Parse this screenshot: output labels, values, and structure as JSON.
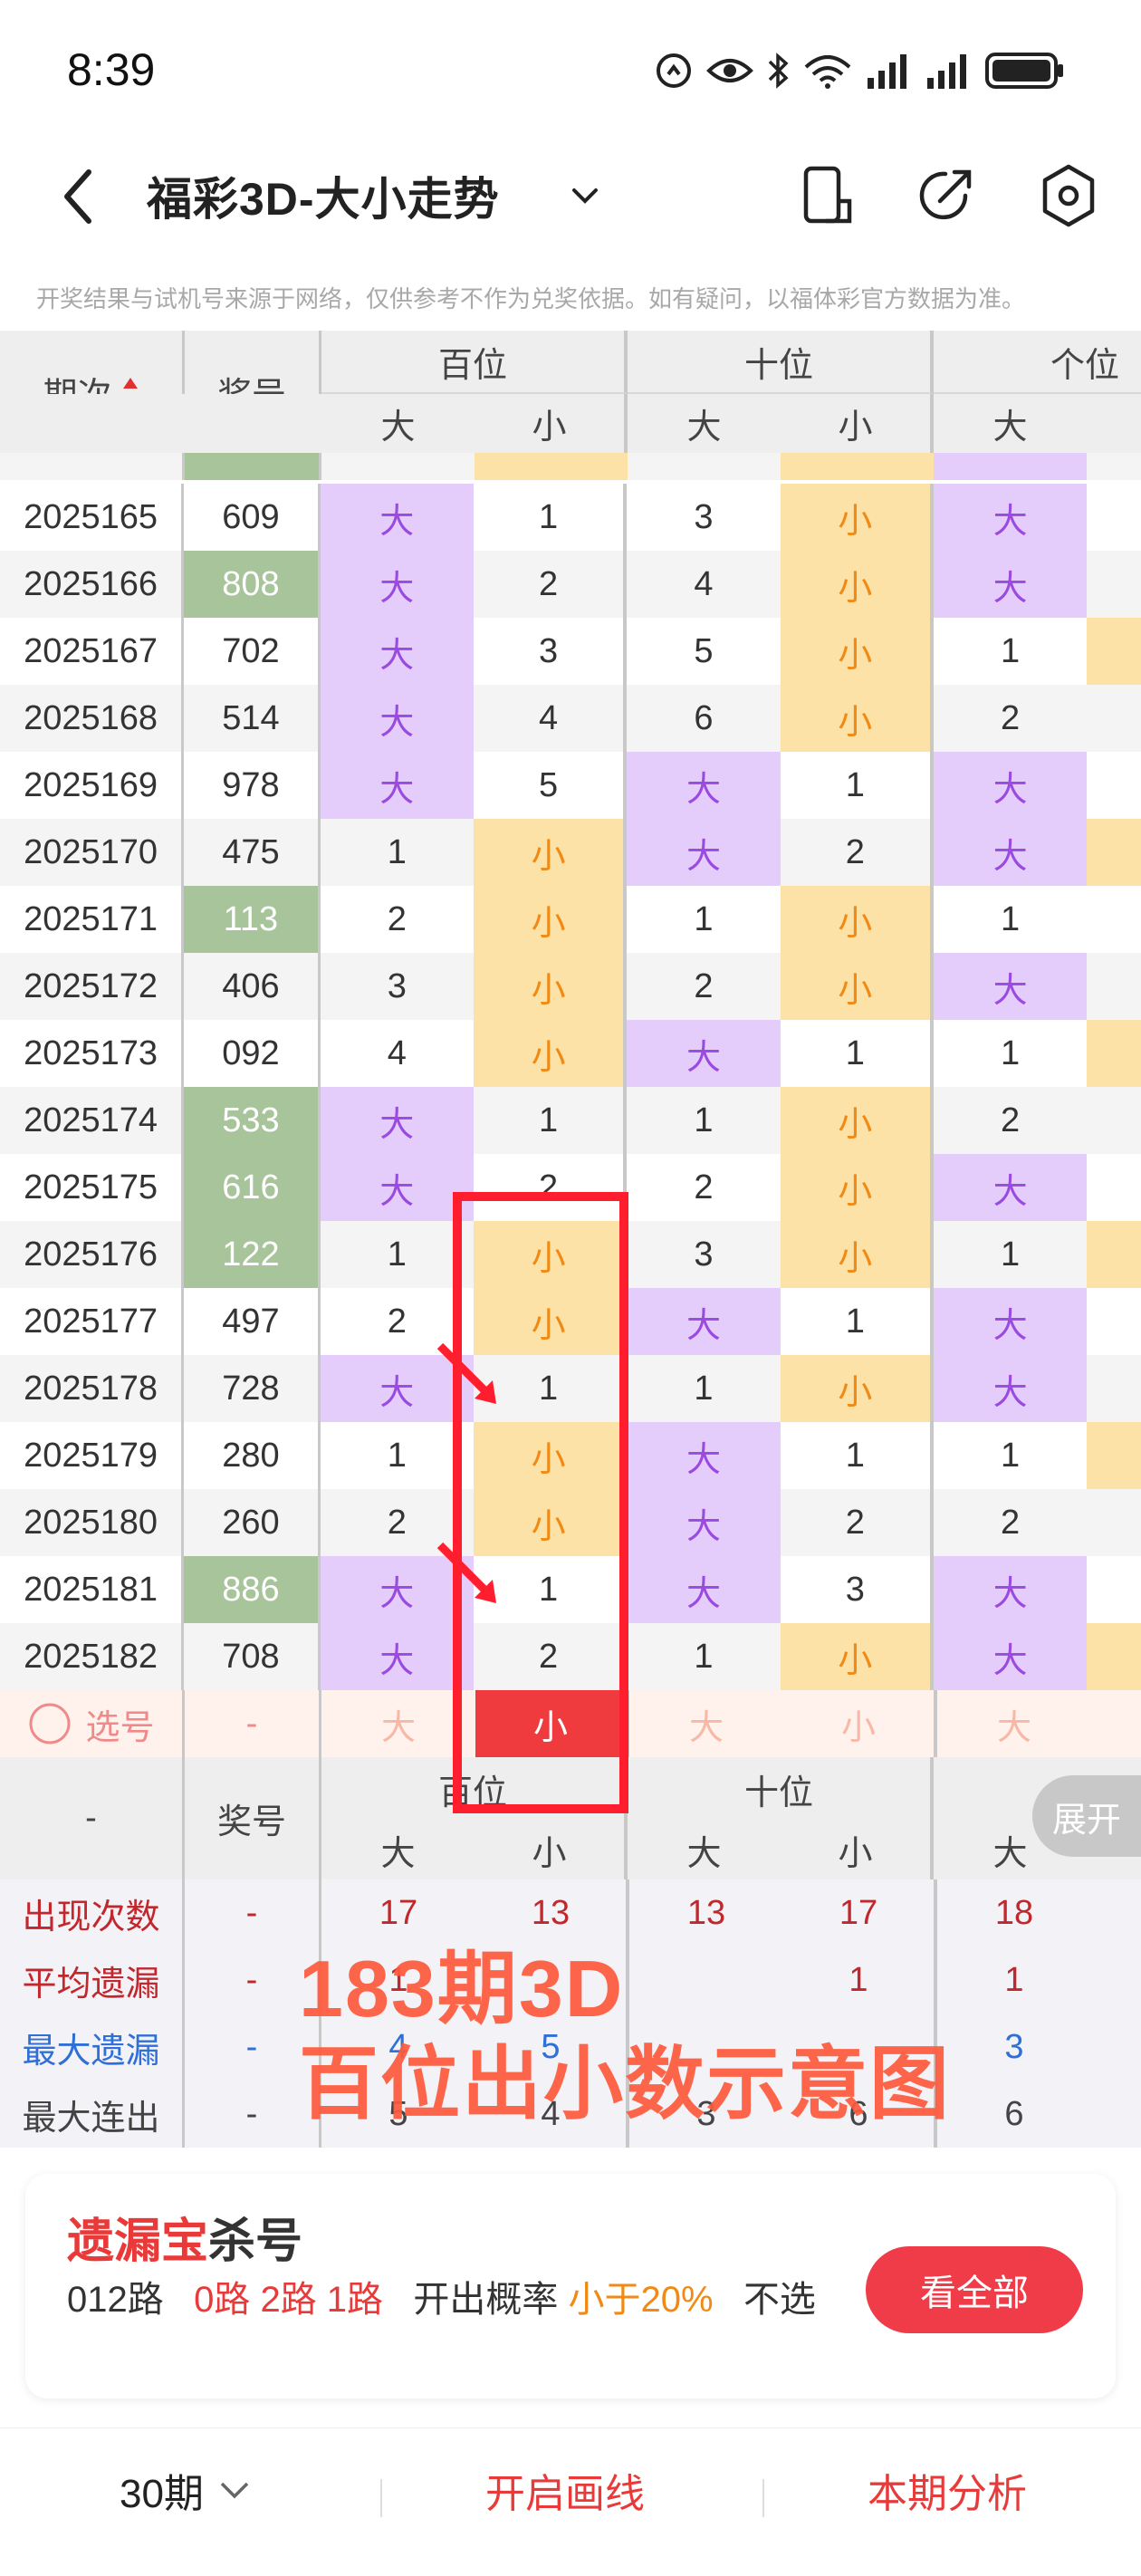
{
  "status_bar": {
    "time": "8:39"
  },
  "header": {
    "title": "福彩3D-大小走势"
  },
  "disclaimer": "开奖结果与试机号来源于网络，仅供参考不作为兑奖依据。如有疑问，以福体彩官方数据为准。",
  "table": {
    "col_period": "期次",
    "col_number": "奖号",
    "groups": [
      "百位",
      "十位",
      "个位"
    ],
    "sub_labels": [
      "大",
      "小"
    ],
    "rows": [
      {
        "period": "2025165",
        "number": "609",
        "green": false,
        "h": [
          "大",
          "1"
        ],
        "t": [
          "3",
          "小"
        ],
        "u": [
          "大",
          ""
        ]
      },
      {
        "period": "2025166",
        "number": "808",
        "green": true,
        "h": [
          "大",
          "2"
        ],
        "t": [
          "4",
          "小"
        ],
        "u": [
          "大",
          ""
        ]
      },
      {
        "period": "2025167",
        "number": "702",
        "green": false,
        "h": [
          "大",
          "3"
        ],
        "t": [
          "5",
          "小"
        ],
        "u": [
          "1",
          ""
        ]
      },
      {
        "period": "2025168",
        "number": "514",
        "green": false,
        "h": [
          "大",
          "4"
        ],
        "t": [
          "6",
          "小"
        ],
        "u": [
          "2",
          ""
        ]
      },
      {
        "period": "2025169",
        "number": "978",
        "green": false,
        "h": [
          "大",
          "5"
        ],
        "t": [
          "大",
          "1"
        ],
        "u": [
          "大",
          ""
        ]
      },
      {
        "period": "2025170",
        "number": "475",
        "green": false,
        "h": [
          "1",
          "小"
        ],
        "t": [
          "大",
          "2"
        ],
        "u": [
          "大",
          ""
        ]
      },
      {
        "period": "2025171",
        "number": "113",
        "green": true,
        "h": [
          "2",
          "小"
        ],
        "t": [
          "1",
          "小"
        ],
        "u": [
          "1",
          ""
        ]
      },
      {
        "period": "2025172",
        "number": "406",
        "green": false,
        "h": [
          "3",
          "小"
        ],
        "t": [
          "2",
          "小"
        ],
        "u": [
          "大",
          ""
        ]
      },
      {
        "period": "2025173",
        "number": "092",
        "green": false,
        "h": [
          "4",
          "小"
        ],
        "t": [
          "大",
          "1"
        ],
        "u": [
          "1",
          ""
        ]
      },
      {
        "period": "2025174",
        "number": "533",
        "green": true,
        "h": [
          "大",
          "1"
        ],
        "t": [
          "1",
          "小"
        ],
        "u": [
          "2",
          ""
        ]
      },
      {
        "period": "2025175",
        "number": "616",
        "green": true,
        "h": [
          "大",
          "2"
        ],
        "t": [
          "2",
          "小"
        ],
        "u": [
          "大",
          ""
        ]
      },
      {
        "period": "2025176",
        "number": "122",
        "green": true,
        "h": [
          "1",
          "小"
        ],
        "t": [
          "3",
          "小"
        ],
        "u": [
          "1",
          ""
        ]
      },
      {
        "period": "2025177",
        "number": "497",
        "green": false,
        "h": [
          "2",
          "小"
        ],
        "t": [
          "大",
          "1"
        ],
        "u": [
          "大",
          ""
        ]
      },
      {
        "period": "2025178",
        "number": "728",
        "green": false,
        "h": [
          "大",
          "1"
        ],
        "t": [
          "1",
          "小"
        ],
        "u": [
          "大",
          ""
        ]
      },
      {
        "period": "2025179",
        "number": "280",
        "green": false,
        "h": [
          "1",
          "小"
        ],
        "t": [
          "大",
          "1"
        ],
        "u": [
          "1",
          ""
        ]
      },
      {
        "period": "2025180",
        "number": "260",
        "green": false,
        "h": [
          "2",
          "小"
        ],
        "t": [
          "大",
          "2"
        ],
        "u": [
          "2",
          ""
        ]
      },
      {
        "period": "2025181",
        "number": "886",
        "green": true,
        "h": [
          "大",
          "1"
        ],
        "t": [
          "大",
          "3"
        ],
        "u": [
          "大",
          ""
        ]
      },
      {
        "period": "2025182",
        "number": "708",
        "green": false,
        "h": [
          "大",
          "2"
        ],
        "t": [
          "1",
          "小"
        ],
        "u": [
          "大",
          ""
        ]
      }
    ],
    "select_row": {
      "label": "选号",
      "dash": "-",
      "cells": [
        "大",
        "小",
        "大",
        "小",
        "大"
      ]
    },
    "footer_dash": "-",
    "footer_number_label": "奖号",
    "expand": "展开",
    "stats": [
      {
        "label": "出现次数",
        "color": "#c0282d",
        "dash": "-",
        "values": [
          "17",
          "13",
          "13",
          "17",
          "18"
        ]
      },
      {
        "label": "平均遗漏",
        "color": "#c0282d",
        "dash": "-",
        "values": [
          "1",
          "",
          "",
          "1",
          "1"
        ]
      },
      {
        "label": "最大遗漏",
        "color": "#2f6fd6",
        "dash": "-",
        "values": [
          "4",
          "5",
          "",
          "",
          "3"
        ]
      },
      {
        "label": "最大连出",
        "color": "#444444",
        "dash": "-",
        "values": [
          "5",
          "4",
          "3",
          "6",
          "6"
        ]
      }
    ]
  },
  "overlay": {
    "line1": "183期3D",
    "line2": "百位出小数示意图"
  },
  "card": {
    "title_red": "遗漏宝",
    "title_black": "杀号",
    "line_a": "012路",
    "line_b": "0路 2路 1路",
    "line_c": "开出概率",
    "line_d": "小于20%",
    "line_e": "不选",
    "button": "看全部"
  },
  "bottom_bar": {
    "periods": "30期",
    "draw_line": "开启画线",
    "analysis": "本期分析"
  }
}
